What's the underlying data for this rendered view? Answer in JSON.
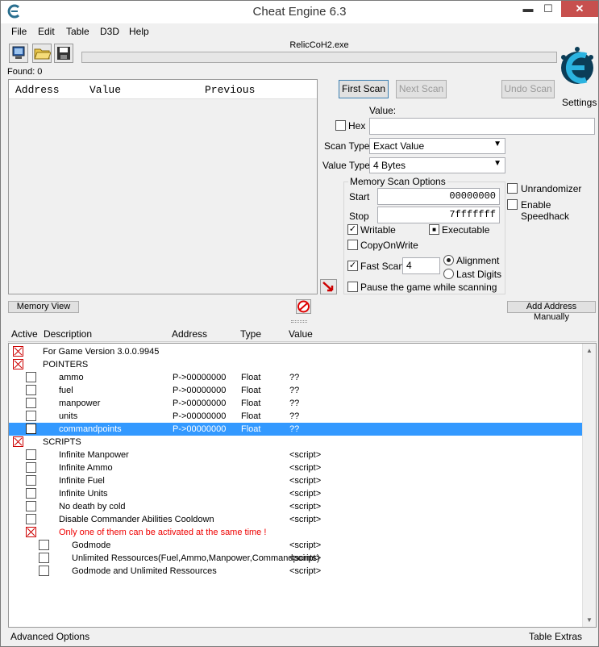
{
  "window": {
    "title": "Cheat Engine 6.3",
    "minimize_glyph": "▬",
    "maximize_glyph": "☐",
    "close_glyph": "✕"
  },
  "menu": [
    "File",
    "Edit",
    "Table",
    "D3D",
    "Help"
  ],
  "process_name": "RelicCoH2.exe",
  "found_label": "Found: 0",
  "results_columns": [
    "Address",
    "Value",
    "Previous"
  ],
  "scan": {
    "first_scan": "First Scan",
    "next_scan": "Next Scan",
    "undo_scan": "Undo Scan",
    "settings": "Settings",
    "value_label": "Value:",
    "hex_label": "Hex",
    "value": "",
    "scan_type_label": "Scan Type",
    "scan_type": "Exact Value",
    "value_type_label": "Value Type",
    "value_type": "4 Bytes"
  },
  "memory_options": {
    "title": "Memory Scan Options",
    "start_label": "Start",
    "start": "00000000",
    "stop_label": "Stop",
    "stop": "7fffffff",
    "writable": "Writable",
    "executable": "Executable",
    "copyonwrite": "CopyOnWrite",
    "fast_scan": "Fast Scan",
    "fast_scan_value": "4",
    "alignment": "Alignment",
    "last_digits": "Last Digits",
    "pause": "Pause the game while scanning"
  },
  "side_options": {
    "unrandomizer": "Unrandomizer",
    "speedhack": "Enable Speedhack"
  },
  "memory_view": "Memory View",
  "add_address": "Add Address Manually",
  "table_columns": [
    "Active",
    "Description",
    "Address",
    "Type",
    "Value"
  ],
  "rows": [
    {
      "desc": "For Game Version 3.0.0.9945",
      "addr": "",
      "type": "",
      "value": ""
    },
    {
      "desc": "POINTERS",
      "addr": "",
      "type": "",
      "value": ""
    },
    {
      "desc": "ammo",
      "addr": "P->00000000",
      "type": "Float",
      "value": "??"
    },
    {
      "desc": "fuel",
      "addr": "P->00000000",
      "type": "Float",
      "value": "??"
    },
    {
      "desc": "manpower",
      "addr": "P->00000000",
      "type": "Float",
      "value": "??"
    },
    {
      "desc": "units",
      "addr": "P->00000000",
      "type": "Float",
      "value": "??"
    },
    {
      "desc": "commandpoints",
      "addr": "P->00000000",
      "type": "Float",
      "value": "??"
    },
    {
      "desc": "SCRIPTS",
      "addr": "",
      "type": "",
      "value": ""
    },
    {
      "desc": "Infinite Manpower",
      "addr": "",
      "type": "",
      "value": "<script>"
    },
    {
      "desc": "Infinite Ammo",
      "addr": "",
      "type": "",
      "value": "<script>"
    },
    {
      "desc": "Infinite Fuel",
      "addr": "",
      "type": "",
      "value": "<script>"
    },
    {
      "desc": "Infinite Units",
      "addr": "",
      "type": "",
      "value": "<script>"
    },
    {
      "desc": "No death by cold",
      "addr": "",
      "type": "",
      "value": "<script>"
    },
    {
      "desc": "Disable Commander Abilities Cooldown",
      "addr": "",
      "type": "",
      "value": "<script>"
    },
    {
      "desc": "Only one of them can be activated at the same time !",
      "addr": "",
      "type": "",
      "value": ""
    },
    {
      "desc": "Godmode",
      "addr": "",
      "type": "",
      "value": "<script>"
    },
    {
      "desc": "Unlimited Ressources(Fuel,Ammo,Manpower,Commandpoints)",
      "addr": "",
      "type": "",
      "value": "<script>"
    },
    {
      "desc": "Godmode and Unlimited Ressources",
      "addr": "",
      "type": "",
      "value": "<script>"
    }
  ],
  "status": {
    "left": "Advanced Options",
    "right": "Table Extras"
  },
  "colors": {
    "selection": "#3399ff",
    "close": "#c7504e",
    "warning_text": "#e00000"
  }
}
